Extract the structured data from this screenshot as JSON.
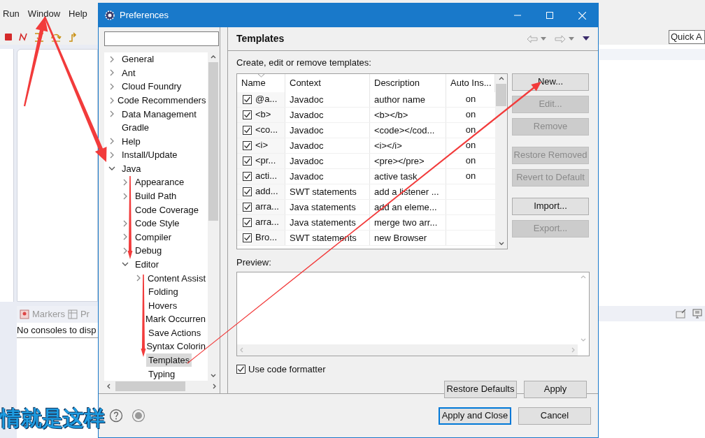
{
  "ide": {
    "menu": [
      "Run",
      "Window",
      "Help"
    ],
    "quick_access": "Quick A",
    "views": [
      {
        "label": "Markers",
        "kind": "markers"
      },
      {
        "label": "Pr",
        "kind": "table"
      }
    ],
    "console_message": "No consoles to disp"
  },
  "dialog": {
    "title": "Preferences",
    "tree": [
      {
        "label": "General",
        "expanded": false,
        "selected": false
      },
      {
        "label": "Ant",
        "expanded": false,
        "selected": false
      },
      {
        "label": "Cloud Foundry",
        "expanded": false,
        "selected": false
      },
      {
        "label": "Code Recommenders",
        "expanded": false,
        "selected": false
      },
      {
        "label": "Data Management",
        "expanded": false,
        "selected": false
      },
      {
        "label": "Gradle",
        "selected": false
      },
      {
        "label": "Help",
        "expanded": false,
        "selected": false
      },
      {
        "label": "Install/Update",
        "expanded": false,
        "selected": false
      },
      {
        "label": "Java",
        "expanded": true,
        "selected": false,
        "children": [
          {
            "label": "Appearance",
            "expanded": false,
            "selected": false
          },
          {
            "label": "Build Path",
            "expanded": false,
            "selected": false
          },
          {
            "label": "Code Coverage",
            "selected": false
          },
          {
            "label": "Code Style",
            "expanded": false,
            "selected": false
          },
          {
            "label": "Compiler",
            "expanded": false,
            "selected": false
          },
          {
            "label": "Debug",
            "expanded": false,
            "selected": false
          },
          {
            "label": "Editor",
            "expanded": true,
            "selected": false,
            "children": [
              {
                "label": "Content Assist",
                "expanded": false,
                "selected": false
              },
              {
                "label": "Folding",
                "selected": false
              },
              {
                "label": "Hovers",
                "selected": false
              },
              {
                "label": "Mark Occurren",
                "selected": false
              },
              {
                "label": "Save Actions",
                "selected": false
              },
              {
                "label": "Syntax Colorin",
                "selected": false
              },
              {
                "label": "Templates",
                "selected": true
              },
              {
                "label": "Typing",
                "selected": false
              }
            ]
          }
        ]
      }
    ],
    "page": {
      "title": "Templates",
      "instruction": "Create, edit or remove templates:",
      "table": {
        "columns": [
          {
            "label": "Name",
            "sorted": true
          },
          {
            "label": "Context",
            "sorted": false
          },
          {
            "label": "Description",
            "sorted": false
          },
          {
            "label": "Auto Ins...",
            "sorted": false
          }
        ],
        "rows": [
          {
            "checked": true,
            "name": "@a...",
            "context": "Javadoc",
            "description": "author name",
            "auto_insert": "on"
          },
          {
            "checked": true,
            "name": "<b>",
            "context": "Javadoc",
            "description": "<b></b>",
            "auto_insert": "on"
          },
          {
            "checked": true,
            "name": "<co...",
            "context": "Javadoc",
            "description": "<code></cod...",
            "auto_insert": "on"
          },
          {
            "checked": true,
            "name": "<i>",
            "context": "Javadoc",
            "description": "<i></i>",
            "auto_insert": "on"
          },
          {
            "checked": true,
            "name": "<pr...",
            "context": "Javadoc",
            "description": "<pre></pre>",
            "auto_insert": "on"
          },
          {
            "checked": true,
            "name": "acti...",
            "context": "Javadoc",
            "description": "active task",
            "auto_insert": "on"
          },
          {
            "checked": true,
            "name": "add...",
            "context": "SWT statements",
            "description": "add a listener ..."
          },
          {
            "checked": true,
            "name": "arra...",
            "context": "Java statements",
            "description": "add an eleme..."
          },
          {
            "checked": true,
            "name": "arra...",
            "context": "Java statements",
            "description": "merge two arr..."
          },
          {
            "checked": true,
            "name": "Bro...",
            "context": "SWT statements",
            "description": "new Browser"
          }
        ]
      },
      "side_button_groups": [
        {
          "buttons": [
            {
              "label": "New...",
              "disabled": false
            },
            {
              "label": "Edit...",
              "disabled": true
            },
            {
              "label": "Remove",
              "disabled": true
            }
          ]
        },
        {
          "buttons": [
            {
              "label": "Restore Removed",
              "disabled": true
            },
            {
              "label": "Revert to Default",
              "disabled": true
            }
          ]
        },
        {
          "buttons": [
            {
              "label": "Import...",
              "disabled": false
            },
            {
              "label": "Export...",
              "disabled": true
            }
          ]
        }
      ],
      "preview_label": "Preview:",
      "formatter": {
        "label": "Use code formatter",
        "checked": true
      },
      "page_buttons": [
        {
          "label": "Restore Defaults"
        },
        {
          "label": "Apply"
        }
      ]
    },
    "footer_buttons": [
      {
        "label": "Apply and Close",
        "default": true
      },
      {
        "label": "Cancel",
        "default": false
      }
    ]
  },
  "caption": "情就是这样"
}
